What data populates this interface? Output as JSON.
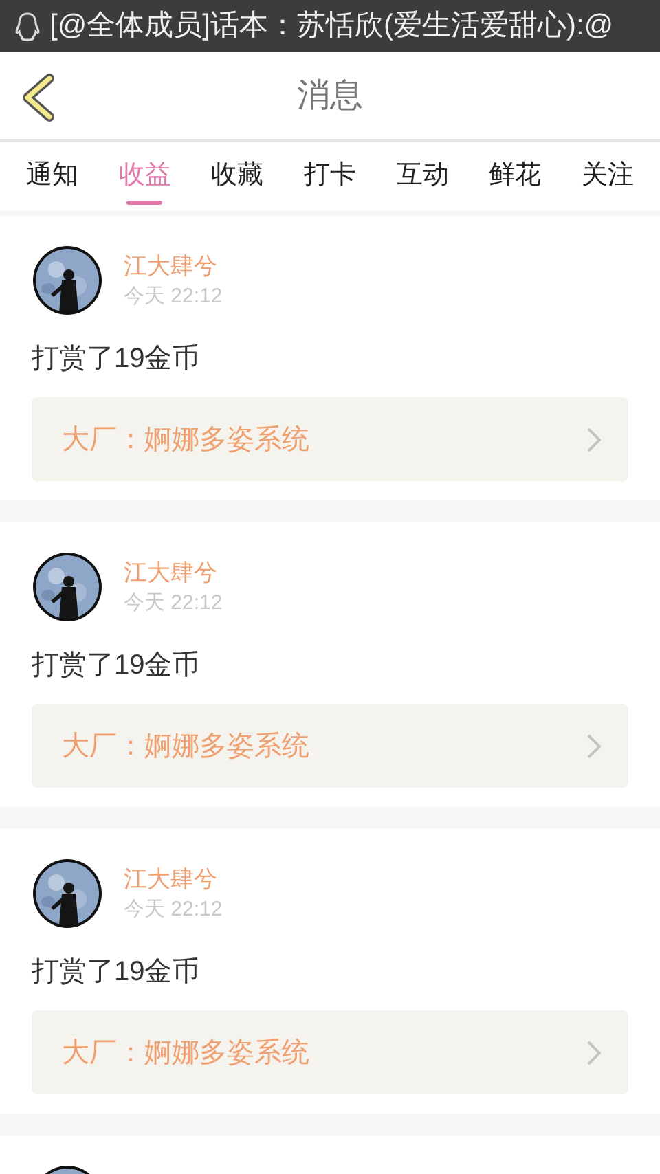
{
  "status_bar": {
    "notification": "[@全体成员]话本：苏恬欣(爱生活爱甜心):@"
  },
  "header": {
    "title": "消息"
  },
  "tabs": [
    {
      "label": "通知",
      "selected": false
    },
    {
      "label": "收益",
      "selected": true
    },
    {
      "label": "收藏",
      "selected": false
    },
    {
      "label": "打卡",
      "selected": false
    },
    {
      "label": "互动",
      "selected": false
    },
    {
      "label": "鲜花",
      "selected": false
    },
    {
      "label": "关注",
      "selected": false
    }
  ],
  "messages": [
    {
      "avatar": {
        "kind": "picture"
      },
      "name": "江大肆兮",
      "time": "今天 22:12",
      "text": "打赏了19金币",
      "link": "大厂：婀娜多姿系统"
    },
    {
      "avatar": {
        "kind": "picture"
      },
      "name": "江大肆兮",
      "time": "今天 22:12",
      "text": "打赏了19金币",
      "link": "大厂：婀娜多姿系统"
    },
    {
      "avatar": {
        "kind": "picture"
      },
      "name": "江大肆兮",
      "time": "今天 22:12",
      "text": "打赏了19金币",
      "link": "大厂：婀娜多姿系统"
    },
    {
      "avatar": {
        "kind": "picture"
      }
    }
  ]
}
